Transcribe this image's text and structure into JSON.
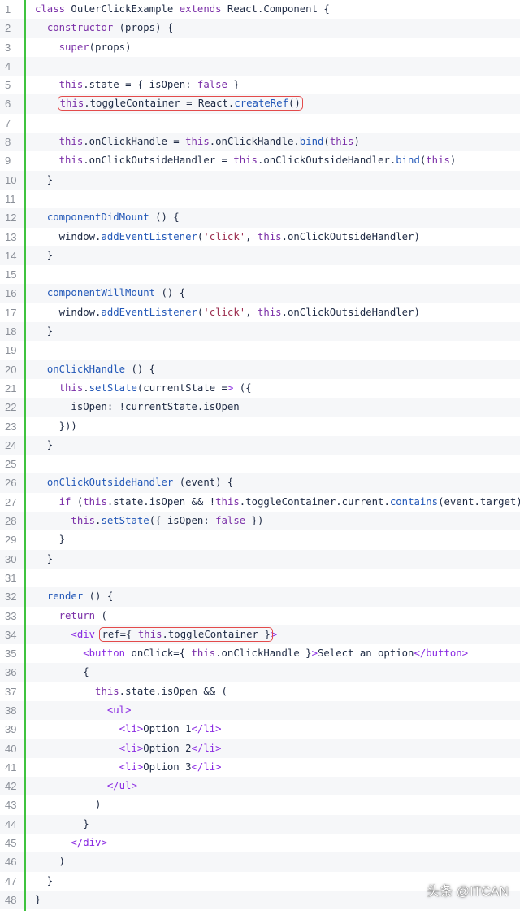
{
  "editor": {
    "gutter_color": "#3fc33f",
    "highlight_color": "#e34b4b",
    "lines": [
      {
        "n": "1",
        "text": "class OuterClickExample extends React.Component {"
      },
      {
        "n": "2",
        "text": "  constructor (props) {"
      },
      {
        "n": "3",
        "text": "    super(props)"
      },
      {
        "n": "4",
        "text": ""
      },
      {
        "n": "5",
        "text": "    this.state = { isOpen: false }"
      },
      {
        "n": "6",
        "text": "    this.toggleContainer = React.createRef()"
      },
      {
        "n": "7",
        "text": ""
      },
      {
        "n": "8",
        "text": "    this.onClickHandle = this.onClickHandle.bind(this)"
      },
      {
        "n": "9",
        "text": "    this.onClickOutsideHandler = this.onClickOutsideHandler.bind(this)"
      },
      {
        "n": "10",
        "text": "  }"
      },
      {
        "n": "11",
        "text": ""
      },
      {
        "n": "12",
        "text": "  componentDidMount () {"
      },
      {
        "n": "13",
        "text": "    window.addEventListener('click', this.onClickOutsideHandler)"
      },
      {
        "n": "14",
        "text": "  }"
      },
      {
        "n": "15",
        "text": ""
      },
      {
        "n": "16",
        "text": "  componentWillMount () {"
      },
      {
        "n": "17",
        "text": "    window.addEventListener('click', this.onClickOutsideHandler)"
      },
      {
        "n": "18",
        "text": "  }"
      },
      {
        "n": "19",
        "text": ""
      },
      {
        "n": "20",
        "text": "  onClickHandle () {"
      },
      {
        "n": "21",
        "text": "    this.setState(currentState => ({"
      },
      {
        "n": "22",
        "text": "      isOpen: !currentState.isOpen"
      },
      {
        "n": "23",
        "text": "    }))"
      },
      {
        "n": "24",
        "text": "  }"
      },
      {
        "n": "25",
        "text": ""
      },
      {
        "n": "26",
        "text": "  onClickOutsideHandler (event) {"
      },
      {
        "n": "27",
        "text": "    if (this.state.isOpen && !this.toggleContainer.current.contains(event.target)) {"
      },
      {
        "n": "28",
        "text": "      this.setState({ isOpen: false })"
      },
      {
        "n": "29",
        "text": "    }"
      },
      {
        "n": "30",
        "text": "  }"
      },
      {
        "n": "31",
        "text": ""
      },
      {
        "n": "32",
        "text": "  render () {"
      },
      {
        "n": "33",
        "text": "    return ("
      },
      {
        "n": "34",
        "text": "      <div ref={ this.toggleContainer }>"
      },
      {
        "n": "35",
        "text": "        <button onClick={ this.onClickHandle }>Select an option</button>"
      },
      {
        "n": "36",
        "text": "        {"
      },
      {
        "n": "37",
        "text": "          this.state.isOpen && ("
      },
      {
        "n": "38",
        "text": "            <ul>"
      },
      {
        "n": "39",
        "text": "              <li>Option 1</li>"
      },
      {
        "n": "40",
        "text": "              <li>Option 2</li>"
      },
      {
        "n": "41",
        "text": "              <li>Option 3</li>"
      },
      {
        "n": "42",
        "text": "            </ul>"
      },
      {
        "n": "43",
        "text": "          )"
      },
      {
        "n": "44",
        "text": "        }"
      },
      {
        "n": "45",
        "text": "      </div>"
      },
      {
        "n": "46",
        "text": "    )"
      },
      {
        "n": "47",
        "text": "  }"
      },
      {
        "n": "48",
        "text": "}"
      }
    ],
    "highlighted": [
      {
        "line": "6",
        "text": "this.toggleContainer = React.createRef()"
      },
      {
        "line": "34",
        "text": "ref={ this.toggleContainer }"
      }
    ]
  },
  "watermark": "头条 @ITCAN"
}
